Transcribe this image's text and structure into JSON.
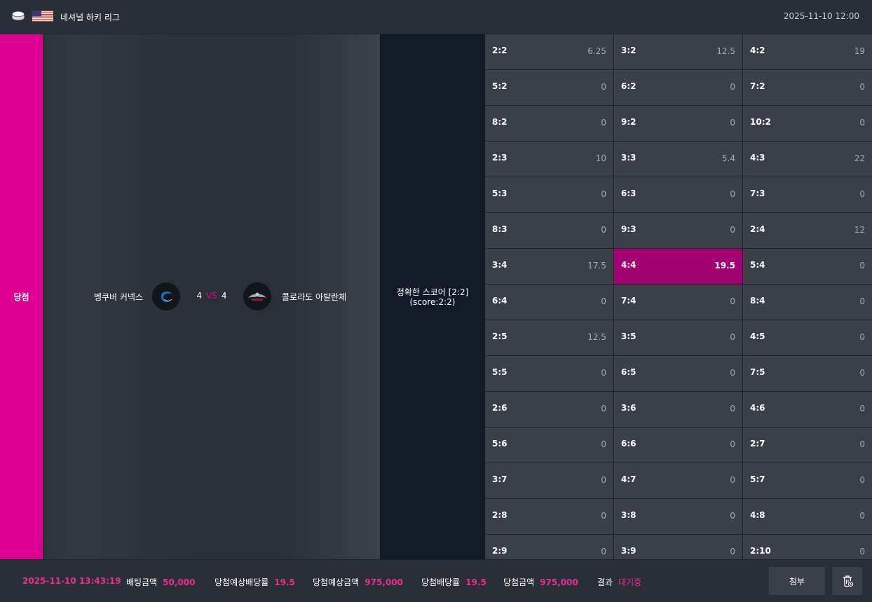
{
  "header": {
    "league_name": "네셔널 하키 리그",
    "datetime": "2025-11-10 12:00",
    "sport_icon": "hockey-puck-icon",
    "country_flag": "usa-flag-icon"
  },
  "bet": {
    "status": "당첨",
    "home_team": "벵쿠버 커넥스",
    "away_team": "콜로라도 아발란체",
    "home_score": "4",
    "away_score": "4",
    "vs_label": "VS",
    "market_line1": "정확한 스코어 [2:2]",
    "market_line2": "(score:2:2)"
  },
  "odds_grid": [
    {
      "label": "2:2",
      "odd": "6.25"
    },
    {
      "label": "3:2",
      "odd": "12.5"
    },
    {
      "label": "4:2",
      "odd": "19"
    },
    {
      "label": "5:2",
      "odd": "0"
    },
    {
      "label": "6:2",
      "odd": "0"
    },
    {
      "label": "7:2",
      "odd": "0"
    },
    {
      "label": "8:2",
      "odd": "0"
    },
    {
      "label": "9:2",
      "odd": "0"
    },
    {
      "label": "10:2",
      "odd": "0"
    },
    {
      "label": "2:3",
      "odd": "10"
    },
    {
      "label": "3:3",
      "odd": "5.4"
    },
    {
      "label": "4:3",
      "odd": "22"
    },
    {
      "label": "5:3",
      "odd": "0"
    },
    {
      "label": "6:3",
      "odd": "0"
    },
    {
      "label": "7:3",
      "odd": "0"
    },
    {
      "label": "8:3",
      "odd": "0"
    },
    {
      "label": "9:3",
      "odd": "0"
    },
    {
      "label": "2:4",
      "odd": "12"
    },
    {
      "label": "3:4",
      "odd": "17.5"
    },
    {
      "label": "4:4",
      "odd": "19.5",
      "selected": true
    },
    {
      "label": "5:4",
      "odd": "0"
    },
    {
      "label": "6:4",
      "odd": "0"
    },
    {
      "label": "7:4",
      "odd": "0"
    },
    {
      "label": "8:4",
      "odd": "0"
    },
    {
      "label": "2:5",
      "odd": "12.5"
    },
    {
      "label": "3:5",
      "odd": "0"
    },
    {
      "label": "4:5",
      "odd": "0"
    },
    {
      "label": "5:5",
      "odd": "0"
    },
    {
      "label": "6:5",
      "odd": "0"
    },
    {
      "label": "7:5",
      "odd": "0"
    },
    {
      "label": "2:6",
      "odd": "0"
    },
    {
      "label": "3:6",
      "odd": "0"
    },
    {
      "label": "4:6",
      "odd": "0"
    },
    {
      "label": "5:6",
      "odd": "0"
    },
    {
      "label": "6:6",
      "odd": "0"
    },
    {
      "label": "2:7",
      "odd": "0"
    },
    {
      "label": "3:7",
      "odd": "0"
    },
    {
      "label": "4:7",
      "odd": "0"
    },
    {
      "label": "5:7",
      "odd": "0"
    },
    {
      "label": "2:8",
      "odd": "0"
    },
    {
      "label": "3:8",
      "odd": "0"
    },
    {
      "label": "4:8",
      "odd": "0"
    },
    {
      "label": "2:9",
      "odd": "0"
    },
    {
      "label": "3:9",
      "odd": "0"
    },
    {
      "label": "2:10",
      "odd": "0"
    }
  ],
  "footer": {
    "bet_time": "2025-11-10 13:43:19",
    "bet_amount_label": "배팅금액",
    "bet_amount": "50,000",
    "expected_odds_label": "당첨예상배당률",
    "expected_odds": "19.5",
    "expected_win_label": "당첨예상금액",
    "expected_win": "975,000",
    "win_odds_label": "당첨배당률",
    "win_odds": "19.5",
    "win_amount_label": "당첨금액",
    "win_amount": "975,000",
    "result_label": "결과",
    "result": "대기중",
    "attach_button": "첨부",
    "delete_icon": "trash-icon"
  },
  "colors": {
    "accent": "#dd0091",
    "selected_cell": "#a30072",
    "highlight_text": "#ee2d93"
  }
}
